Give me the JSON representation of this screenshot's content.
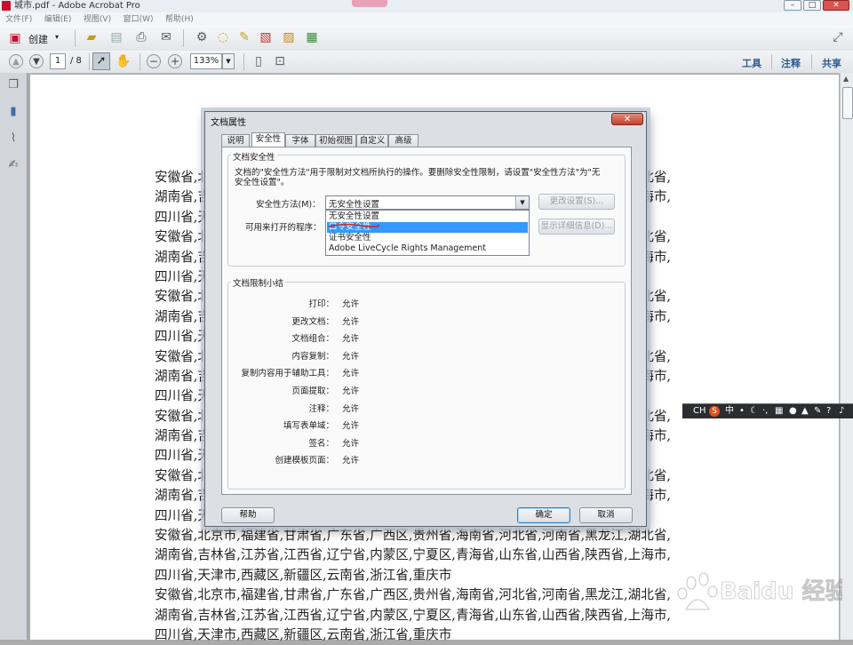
{
  "window": {
    "title": "城市.pdf - Adobe Acrobat Pro",
    "min": "–",
    "max": "□",
    "close": "✕"
  },
  "menu": [
    "文件(F)",
    "编辑(E)",
    "视图(V)",
    "窗口(W)",
    "帮助(H)"
  ],
  "toolbar": {
    "create_label": "创建",
    "page_current": "1",
    "page_total": "/ 8",
    "zoom": "133%",
    "tools_label": "工具",
    "comment_label": "注释",
    "share_label": "共享"
  },
  "document": {
    "lines": [
      "安徽省,北京市,福建省,甘肃省,广东省,广西区,贵州省,海南省,河北省,河南省,黑龙江,湖北省,",
      "湖南省,吉林省,江苏省,江西省,辽宁省,内蒙区,宁夏区,青海省,山东省,山西省,陕西省,上海市,",
      "四川省,天津市,西藏区,新疆区,云南省,浙江省,重庆市",
      "安徽省,北京市,福建省,甘肃省,广东省,广西区,贵州省,海南省,河北省,河南省,黑龙江,湖北省,",
      "湖南省,吉林省,江苏省,江西省,辽宁省,内蒙区,宁夏区,青海省,山东省,山西省,陕西省,上海市,",
      "四川省,天津市,西藏区,新疆区,云南省,浙江省,重庆市",
      "安徽省,北京市,福建省,甘肃省,广东省,广西区,贵州省,海南省,河北省,河南省,黑龙江,湖北省,",
      "湖南省,吉林省,江苏省,江西省,辽宁省,内蒙区,宁夏区,青海省,山东省,山西省,陕西省,上海市,",
      "四川省,天津市,西藏区,新疆区,云南省,浙江省,重庆市",
      "安徽省,北京市,福建省,甘肃省,广东省,广西区,贵州省,海南省,河北省,河南省,黑龙江,湖北省,",
      "湖南省,吉林省,江苏省,江西省,辽宁省,内蒙区,宁夏区,青海省,山东省,山西省,陕西省,上海市,",
      "四川省,天津市,西藏区,新疆区,云南省,浙江省,重庆市",
      "安徽省,北京市,福建省,甘肃省,广东省,广西区,贵州省,海南省,河北省,河南省,黑龙江,湖北省,",
      "湖南省,吉林省,江苏省,江西省,辽宁省,内蒙区,宁夏区,青海省,山东省,山西省,陕西省,上海市,",
      "四川省,天津市,西藏区,新疆区,云南省,浙江省,重庆市",
      "安徽省,北京市,福建省,甘肃省,广东省,广西区,贵州省,海南省,河北省,河南省,黑龙江,湖北省,",
      "湖南省,吉林省,江苏省,江西省,辽宁省,内蒙区,宁夏区,青海省,山东省,山西省,陕西省,上海市,",
      "四川省,天津市,西藏区,新疆区,云南省,浙江省,重庆市",
      "安徽省,北京市,福建省,甘肃省,广东省,广西区,贵州省,海南省,河北省,河南省,黑龙江,湖北省,",
      "湖南省,吉林省,江苏省,江西省,辽宁省,内蒙区,宁夏区,青海省,山东省,山西省,陕西省,上海市,",
      "四川省,天津市,西藏区,新疆区,云南省,浙江省,重庆市",
      "安徽省,北京市,福建省,甘肃省,广东省,广西区,贵州省,海南省,河北省,河南省,黑龙江,湖北省,",
      "湖南省,吉林省,江苏省,江西省,辽宁省,内蒙区,宁夏区,青海省,山东省,山西省,陕西省,上海市,",
      "四川省,天津市,西藏区,新疆区,云南省,浙江省,重庆市"
    ]
  },
  "dialog": {
    "title": "文档属性",
    "close": "✕",
    "tabs": [
      "说明",
      "安全性",
      "字体",
      "初始视图",
      "自定义",
      "高级"
    ],
    "active_tab": "安全性",
    "security": {
      "group_title": "文档安全性",
      "description_line1": "文档的\"安全性方法\"用于限制对文档所执行的操作。要删除安全性限制，请设置\"安全性方法\"为\"无",
      "description_line2": "安全性设置\"。",
      "method_label": "安全性方法(M)：",
      "method_value": "无安全性设置",
      "change_settings": "更改设置(S)...",
      "can_open_label": "可用来打开的程序：",
      "show_details": "显示详细信息(D)...",
      "options": [
        "无安全性设置",
        "口令安全性",
        "证书安全性",
        "Adobe LiveCycle Rights Management"
      ],
      "highlighted_option": "口令安全性"
    },
    "restrictions": {
      "group_title": "文档限制小结",
      "rows": [
        {
          "label": "打印：",
          "value": "允许"
        },
        {
          "label": "更改文档：",
          "value": "允许"
        },
        {
          "label": "文档组合：",
          "value": "允许"
        },
        {
          "label": "内容复制：",
          "value": "允许"
        },
        {
          "label": "复制内容用于辅助工具：",
          "value": "允许"
        },
        {
          "label": "页面提取：",
          "value": "允许"
        },
        {
          "label": "注释：",
          "value": "允许"
        },
        {
          "label": "填写表单域：",
          "value": "允许"
        },
        {
          "label": "签名：",
          "value": "允许"
        },
        {
          "label": "创建模板页面：",
          "value": "允许"
        }
      ]
    },
    "help": "帮助",
    "ok": "确定",
    "cancel": "取消"
  },
  "ime": {
    "label": "CH",
    "mode": "中"
  },
  "watermark": {
    "text": "Baidu 经验"
  },
  "colors": {
    "accent": "#2e5d95",
    "selection": "#3399ff",
    "acrobat_red": "#c8102e"
  }
}
